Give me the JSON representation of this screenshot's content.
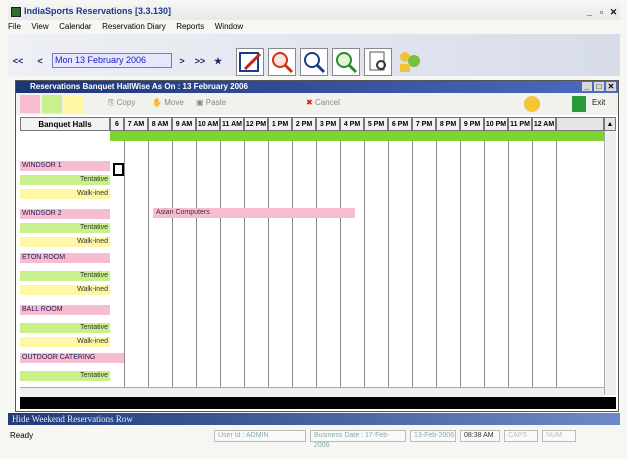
{
  "app": {
    "title": "IndiaSports Reservations [3.3.130]"
  },
  "menu": [
    "File",
    "View",
    "Calendar",
    "Reservation Diary",
    "Reports",
    "Window"
  ],
  "nav": {
    "date_value": "Mon 13 February 2006",
    "prev2": "<<",
    "prev1": "<",
    "next1": ">",
    "next2": ">>",
    "pin": "★"
  },
  "inner_window": {
    "title": "Reservations Banquet HallWise As On : 13 February 2006",
    "toolbar": {
      "copy": "Copy",
      "move": "Move",
      "paste": "Paste",
      "cancel": "Cancel",
      "exit": "Exit"
    }
  },
  "grid": {
    "header_label": "Banquet Halls",
    "time_slots": [
      "6 AM",
      "7 AM",
      "8 AM",
      "9 AM",
      "10 AM",
      "11 AM",
      "12 PM",
      "1 PM",
      "2 PM",
      "3 PM",
      "4 PM",
      "5 PM",
      "6 PM",
      "7 PM",
      "8 PM",
      "9 PM",
      "10 PM",
      "11 PM",
      "12 AM"
    ],
    "halls": [
      {
        "name": "WINDSOR 1",
        "tentative": "Tentative",
        "walked": "Walk-ined"
      },
      {
        "name": "WINDSOR 2",
        "tentative": "Tentative",
        "walked": "Walk-ined"
      },
      {
        "name": "ETON ROOM",
        "tentative": "Tentative",
        "walked": "Walk-ined"
      },
      {
        "name": "BALL ROOM",
        "tentative": "Tentative",
        "walked": "Walk-ined"
      },
      {
        "name": "OUTDOOR CATERING",
        "tentative": "Tentative",
        "walked": ""
      }
    ],
    "booking": {
      "label": "Asian Computers"
    }
  },
  "band": {
    "text": "Hide Weekend Reservations Row"
  },
  "status": {
    "ready": "Ready",
    "user": "User Id : ADMIN",
    "business_date": "Business Date : 17-Feb-2006",
    "date": "13-Feb-2006",
    "time": "08:38 AM",
    "caps": "CAPS",
    "num": "NUM"
  },
  "colors": {
    "hall": "#f8bcd1",
    "tentative": "#c9f08a",
    "walkin": "#fff7a6",
    "time_row": "#7ed42e",
    "title_bar": "#1b3575"
  }
}
